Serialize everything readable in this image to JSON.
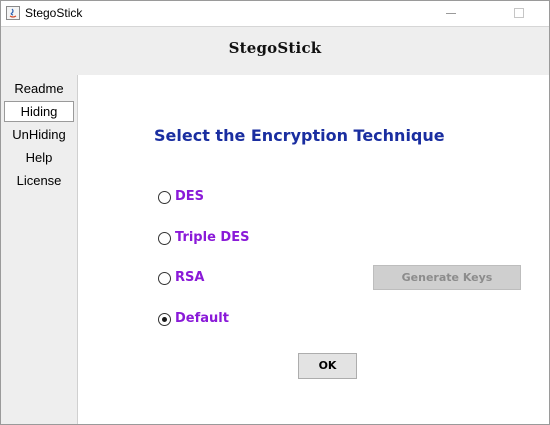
{
  "window": {
    "title": "StegoStick",
    "icon": "java-app-icon"
  },
  "header": {
    "title": "StegoStick"
  },
  "sidebar": {
    "items": [
      {
        "label": "Readme",
        "active": false
      },
      {
        "label": "Hiding",
        "active": true
      },
      {
        "label": "UnHiding",
        "active": false
      },
      {
        "label": "Help",
        "active": false
      },
      {
        "label": "License",
        "active": false
      }
    ]
  },
  "main": {
    "title": "Select the Encryption Technique",
    "options": [
      {
        "label": "DES",
        "checked": false
      },
      {
        "label": "Triple DES",
        "checked": false
      },
      {
        "label": "RSA",
        "checked": false
      },
      {
        "label": "Default",
        "checked": true
      }
    ],
    "generate_keys_label": "Generate Keys",
    "generate_keys_enabled": false,
    "ok_label": "OK"
  },
  "colors": {
    "title_blue": "#1a2ea0",
    "option_purple": "#8a1ad8",
    "panel_gray": "#eeeeee"
  }
}
